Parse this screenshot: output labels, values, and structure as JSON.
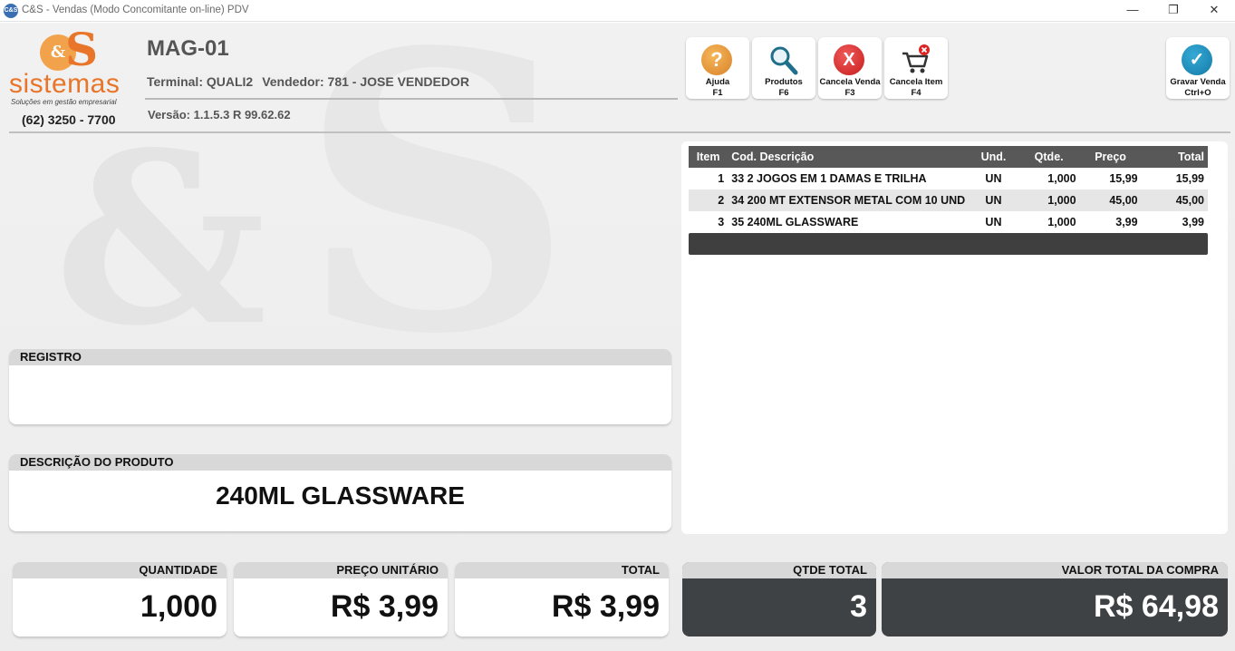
{
  "window": {
    "title": "C&S - Vendas (Modo Concomitante on-line) PDV",
    "app_icon": "C&S",
    "minimize": "—",
    "maximize": "❐",
    "close": "✕"
  },
  "logo": {
    "mark_circle": "&",
    "mark_s": "S",
    "name": "sistemas",
    "tagline": "Soluções em gestão empresarial",
    "phone": "(62) 3250 - 7700"
  },
  "header": {
    "store": "MAG-01",
    "terminal": "Terminal: QUALI2",
    "vendedor": "Vendedor: 781 - JOSE VENDEDOR",
    "versao": "Versão: 1.1.5.3 R 99.62.62"
  },
  "toolbar": [
    {
      "label": "Ajuda",
      "key": "F1",
      "icon": "help-icon",
      "glyph": "?"
    },
    {
      "label": "Produtos",
      "key": "F6",
      "icon": "search-icon",
      "glyph": ""
    },
    {
      "label": "Cancela Venda",
      "key": "F3",
      "icon": "cancel-icon",
      "glyph": "X"
    },
    {
      "label": "Cancela Item",
      "key": "F4",
      "icon": "cart-remove-icon",
      "glyph": ""
    },
    {
      "label": "Gravar Venda",
      "key": "Ctrl+O",
      "icon": "check-icon",
      "glyph": "✓"
    }
  ],
  "items_table": {
    "headers": [
      "Item",
      "Cod. Descrição",
      "Und.",
      "Qtde.",
      "Preço",
      "Total"
    ],
    "rows": [
      {
        "item": "1",
        "desc": "33 2 JOGOS EM 1 DAMAS E TRILHA",
        "und": "UN",
        "qtde": "1,000",
        "preco": "15,99",
        "total": "15,99"
      },
      {
        "item": "2",
        "desc": "34 200 MT EXTENSOR METAL COM 10 UND",
        "und": "UN",
        "qtde": "1,000",
        "preco": "45,00",
        "total": "45,00"
      },
      {
        "item": "3",
        "desc": "35 240ML GLASSWARE",
        "und": "UN",
        "qtde": "1,000",
        "preco": "3,99",
        "total": "3,99"
      }
    ]
  },
  "registro": {
    "label": "REGISTRO",
    "value": ""
  },
  "descricao": {
    "label": "DESCRIÇÃO DO PRODUTO",
    "value": "240ML GLASSWARE"
  },
  "quantidade": {
    "label": "QUANTIDADE",
    "value": "1,000"
  },
  "preco_unitario": {
    "label": "PREÇO UNITÁRIO",
    "value": "R$ 3,99"
  },
  "total": {
    "label": "TOTAL",
    "value": "R$ 3,99"
  },
  "qtde_total": {
    "label": "QTDE TOTAL",
    "value": "3"
  },
  "valor_total": {
    "label": "VALOR TOTAL DA COMPRA",
    "value": "R$ 64,98"
  },
  "colors": {
    "brand_orange": "#e8752a",
    "dark_panel": "#3f4244",
    "table_header": "#585858"
  }
}
